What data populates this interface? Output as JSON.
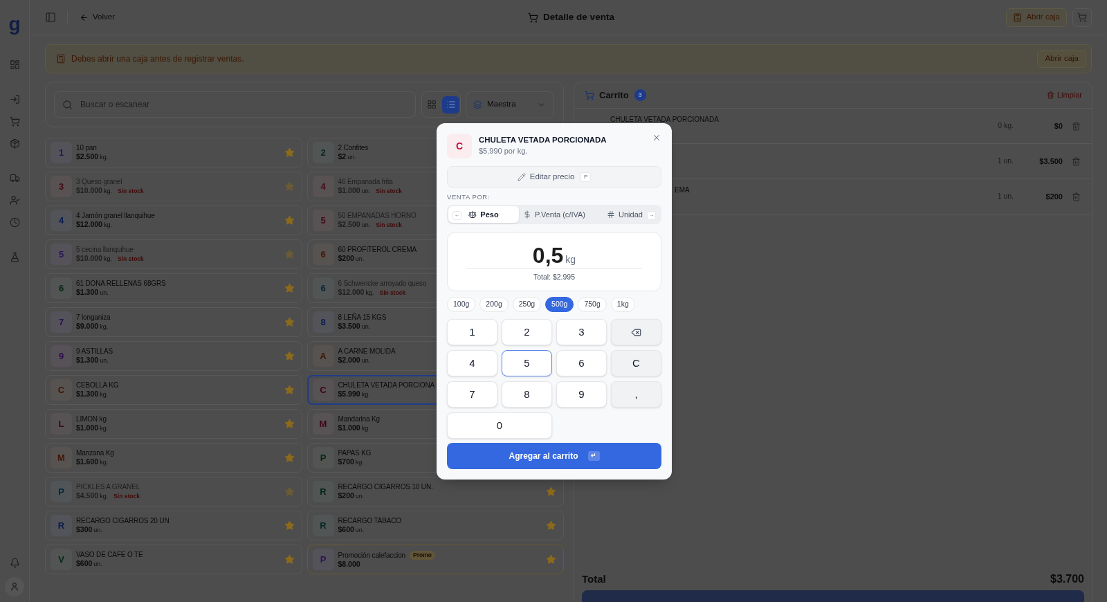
{
  "sidebar": {
    "logo": "g"
  },
  "topbar": {
    "back": "Volver",
    "title": "Detalle de venta",
    "open_register": "Abrir caja"
  },
  "alert": {
    "message": "Debes abrir una caja antes de registrar ventas.",
    "action": "Abrir caja"
  },
  "search": {
    "placeholder": "Buscar o escanear"
  },
  "view_modes": [
    {
      "kind": "grid",
      "selected": false
    },
    {
      "kind": "list",
      "selected": true
    }
  ],
  "price_list": {
    "value": "Maestra"
  },
  "products": [
    {
      "initial": "1",
      "color": "#2c1057",
      "name": "10 pan",
      "price": "$2.500",
      "unit": "kg.",
      "available": true,
      "favorite": true,
      "selected": false
    },
    {
      "initial": "2",
      "color": "#052724",
      "name": "2 Confites",
      "price": "$2",
      "unit": "un.",
      "available": true,
      "selected": false
    },
    {
      "initial": "3",
      "color": "#440916",
      "name": "3 Queso granel",
      "price": "$10.000",
      "unit": "kg.",
      "available": false,
      "stock_label": "Sin stock",
      "favorite": true,
      "selected": false
    },
    {
      "initial": "4",
      "color": "#440916",
      "name": "46 Empanada frita",
      "price": "$1.000",
      "unit": "un.",
      "available": false,
      "stock_label": "Sin stock",
      "selected": false
    },
    {
      "initial": "4",
      "color": "#0a1b4c",
      "name": "4 Jamón granel llanquihue",
      "price": "$12.000",
      "unit": "kg.",
      "available": true,
      "favorite": true,
      "selected": false
    },
    {
      "initial": "5",
      "color": "#440916",
      "name": "50 EMPANADAS HORNO",
      "price": "$2.500",
      "unit": "un.",
      "available": false,
      "stock_label": "Sin stock",
      "selected": false
    },
    {
      "initial": "5",
      "color": "#2b1453",
      "name": "5 cecina llanquihue",
      "price": "$10.000",
      "unit": "kg.",
      "available": false,
      "stock_label": "Sin stock",
      "favorite": true,
      "selected": false
    },
    {
      "initial": "6",
      "color": "#401504",
      "name": "60 PROFITEROL CREMA",
      "price": "$200",
      "unit": "un.",
      "available": true,
      "selected": false
    },
    {
      "initial": "6",
      "color": "#062612",
      "name": "61 DONA RELLENAS 68GRS",
      "price": "$1.300",
      "unit": "un.",
      "available": true,
      "favorite": true,
      "selected": false
    },
    {
      "initial": "6",
      "color": "#02262e",
      "name": "6 Schwencke arroyado queso",
      "price": "$12.000",
      "unit": "kg.",
      "available": false,
      "stock_label": "Sin stock",
      "selected": false
    },
    {
      "initial": "7",
      "color": "#2c1057",
      "name": "7 longaniza",
      "price": "$9.000",
      "unit": "kg.",
      "available": true,
      "favorite": true,
      "selected": false
    },
    {
      "initial": "8",
      "color": "#0a1b4c",
      "name": "8 LEÑA 15 KGS",
      "price": "$3.500",
      "unit": "un.",
      "available": true,
      "selected": false
    },
    {
      "initial": "9",
      "color": "#2d0c4a",
      "name": "9 ASTILLAS",
      "price": "$1.300",
      "unit": "un.",
      "available": true,
      "favorite": true,
      "selected": false
    },
    {
      "initial": "A",
      "color": "#401504",
      "name": "A CARNE MOLIDA",
      "price": "$2.000",
      "unit": "un.",
      "available": true,
      "selected": false
    },
    {
      "initial": "C",
      "color": "#401504",
      "name": "CEBOLLA KG",
      "price": "$1.300",
      "unit": "kg.",
      "available": true,
      "favorite": true,
      "selected": false
    },
    {
      "initial": "C",
      "color": "#3f0614",
      "name": "CHULETA VETADA PORCIONA",
      "price": "$5.990",
      "unit": "kg.",
      "available": true,
      "selected": true
    },
    {
      "initial": "L",
      "color": "#3f0614",
      "name": "LIMON kg",
      "price": "$1.000",
      "unit": "kg.",
      "available": true,
      "favorite": true,
      "selected": false
    },
    {
      "initial": "M",
      "color": "#3f0614",
      "name": "Mandarina Kg",
      "price": "$1.000",
      "unit": "kg.",
      "available": true,
      "selected": false
    },
    {
      "initial": "M",
      "color": "#401504",
      "name": "Manzana Kg",
      "price": "$1.600",
      "unit": "kg.",
      "available": true,
      "favorite": true,
      "selected": false
    },
    {
      "initial": "P",
      "color": "#062612",
      "name": "PAPAS KG",
      "price": "$700",
      "unit": "kg.",
      "available": true,
      "selected": false
    },
    {
      "initial": "P",
      "color": "#012538",
      "name": "PICKLES A GRANEL",
      "price": "$4.500",
      "unit": "kg.",
      "available": false,
      "stock_label": "Sin stock",
      "favorite": true,
      "selected": false
    },
    {
      "initial": "R",
      "color": "#01241a",
      "name": "RECARGO CIGARROS 10 UN.",
      "price": "$200",
      "unit": "un.",
      "available": true,
      "favorite": true,
      "selected": false
    },
    {
      "initial": "R",
      "color": "#0a1b4c",
      "name": "RECARGO CIGARROS 20 UN",
      "price": "$300",
      "unit": "un.",
      "available": true,
      "favorite": true,
      "selected": false
    },
    {
      "initial": "R",
      "color": "#052724",
      "name": "RECARGO TABACO",
      "price": "$600",
      "unit": "un.",
      "available": true,
      "favorite": true,
      "selected": false
    },
    {
      "initial": "V",
      "color": "#062612",
      "name": "VASO DE CAFE O TE",
      "price": "$600",
      "unit": "un.",
      "available": true,
      "favorite": true,
      "selected": false
    },
    {
      "initial": "P",
      "color": "#2c1057",
      "name": "Promoción calefaccion",
      "badge": "Promo",
      "price": "$8.000",
      "available": true,
      "favorite": true,
      "selected": false
    }
  ],
  "cart": {
    "title": "Carrito",
    "count": "3",
    "clear": "Limpiar",
    "items": [
      {
        "name": "CHULETA VETADA PORCIONADA",
        "covered": false,
        "quantity": "0 kg.",
        "price": "$0"
      },
      {
        "quantity": "1 un.",
        "price": "$3.500"
      },
      {
        "name": "EMA",
        "covered": true,
        "quantity": "1 un.",
        "price": "$200"
      }
    ],
    "total_label": "Total",
    "total": "$3.700"
  },
  "modal": {
    "product": {
      "initial": "C",
      "color": "#be123c",
      "name": "CHULETA VETADA PORCIONADA",
      "unit_price": "$5.990 por kg."
    },
    "edit_price": {
      "label": "Editar precio",
      "key": "P"
    },
    "sell_by": {
      "label": "VENTA POR:",
      "prev_key": "←",
      "next_key": "→",
      "options": [
        {
          "kind": "weight",
          "label": "Peso",
          "selected": true
        },
        {
          "kind": "price",
          "label": "P.Venta (c/IVA)",
          "selected": false
        },
        {
          "kind": "unit",
          "label": "Unidad",
          "selected": false
        }
      ]
    },
    "display": {
      "amount": "0,5",
      "unit": "kg",
      "total": "Total: $2.995"
    },
    "presets": [
      {
        "label": "100g",
        "selected": false
      },
      {
        "label": "200g",
        "selected": false
      },
      {
        "label": "250g",
        "selected": false
      },
      {
        "label": "500g",
        "selected": true
      },
      {
        "label": "750g",
        "selected": false
      },
      {
        "label": "1kg",
        "selected": false
      }
    ],
    "keypad": [
      {
        "kind": "digit",
        "label": "1",
        "focused": false
      },
      {
        "kind": "digit",
        "label": "2",
        "focused": false
      },
      {
        "kind": "digit",
        "label": "3",
        "focused": false
      },
      {
        "kind": "backspace",
        "focused": false
      },
      {
        "kind": "digit",
        "label": "4",
        "focused": false
      },
      {
        "kind": "digit",
        "label": "5",
        "focused": true
      },
      {
        "kind": "digit",
        "label": "6",
        "focused": false
      },
      {
        "kind": "clear",
        "label": "C",
        "focused": false
      },
      {
        "kind": "digit",
        "label": "7",
        "focused": false
      },
      {
        "kind": "digit",
        "label": "8",
        "focused": false
      },
      {
        "kind": "digit",
        "label": "9",
        "focused": false
      },
      {
        "kind": "decimal",
        "label": ",",
        "focused": false
      },
      {
        "kind": "wide-digit",
        "label": "0",
        "focused": false
      }
    ],
    "submit": {
      "label": "Agregar al carrito",
      "key": "↵"
    }
  }
}
